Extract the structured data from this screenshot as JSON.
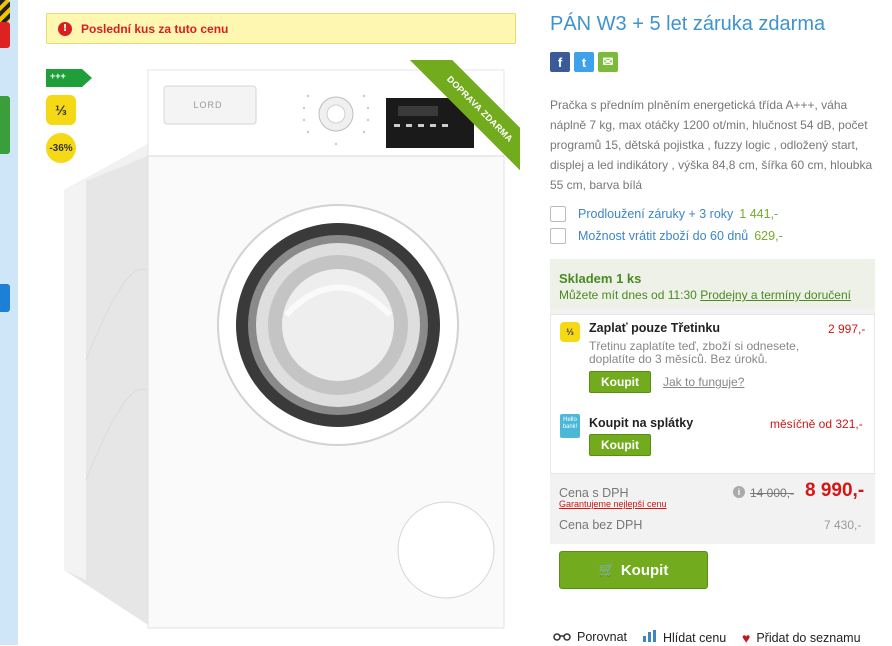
{
  "stock_banner": {
    "text": "Poslední kus za tuto cenu",
    "icon": "info-icon"
  },
  "badges": {
    "energy": "+++",
    "third": "⅓",
    "discount": "-36%",
    "ribbon": "DOPRAVA ZDARMA"
  },
  "product": {
    "title": "PÁN W3 + 5 let záruka zdarma",
    "brand_on_image": "LORD",
    "description": "Pračka s předním plněním energetická třída A+++, váha náplně 7 kg, max otáčky 1200 ot/min, hlučnost 54 dB, počet programů 15, dětská pojistka , fuzzy logic , odložený start, displej a led indikátory , výška 84,8 cm, šířka 60 cm, hloubka 55 cm, barva bílá"
  },
  "share": {
    "facebook": "f",
    "twitter": "t",
    "email": "✉"
  },
  "options": [
    {
      "label": "Prodloužení záruky + 3 roky",
      "price": "1 441,-"
    },
    {
      "label": "Možnost vrátit zboží do 60 dnů",
      "price": "629,-"
    }
  ],
  "availability": {
    "status": "Skladem 1 ks",
    "delivery_prefix": "Můžete mít dnes od 11:30",
    "delivery_link": "Prodejny a termíny doručení"
  },
  "payment_third": {
    "title": "Zaplať pouze Třetinku",
    "price": "2 997,-",
    "note": "Třetinu zaplatíte teď, zboží si odnesete, doplatíte do 3 měsíců. Bez úroků.",
    "button": "Koupit",
    "link": "Jak to funguje?"
  },
  "payment_installments": {
    "title": "Koupit na splátky",
    "price": "měsíčně od 321,-",
    "button": "Koupit",
    "icon_text": "Hello bank!"
  },
  "pricing": {
    "with_vat_label": "Cena s DPH",
    "guarantee_link": "Garantujeme nejlepší cenu",
    "old_price": "14 000,-",
    "new_price": "8 990,-",
    "without_vat_label": "Cena bez DPH",
    "without_vat_price": "7 430,-"
  },
  "buy_button": "Koupit",
  "actions": {
    "compare": "Porovnat",
    "watch_price": "Hlídat cenu",
    "add_to_list": "Přidat do seznamu"
  },
  "colors": {
    "accent_blue": "#3d93d1",
    "green": "#72ab1d",
    "price_red": "#d61515",
    "badge_yellow": "#f5d915"
  }
}
